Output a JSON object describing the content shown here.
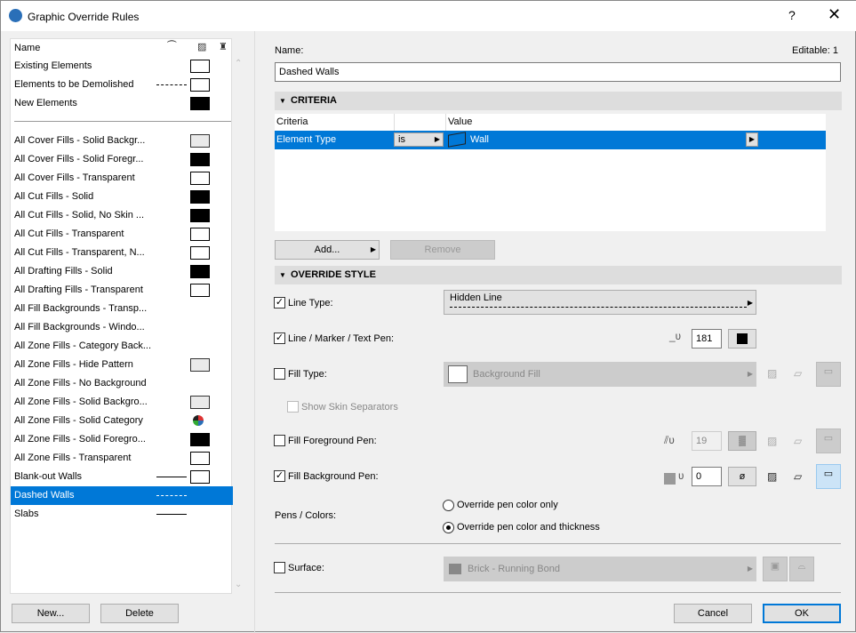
{
  "window": {
    "title": "Graphic Override Rules",
    "help": "?",
    "close": "✕"
  },
  "list": {
    "header": "Name",
    "items": [
      {
        "label": "Existing Elements",
        "swatch": "white",
        "line": ""
      },
      {
        "label": "Elements to be Demolished",
        "swatch": "white",
        "line": "dash"
      },
      {
        "label": "New Elements",
        "swatch": "black",
        "line": ""
      },
      {
        "label": "All Cover Fills - Solid Backgr...",
        "swatch": "gray",
        "line": ""
      },
      {
        "label": "All Cover Fills - Solid Foregr...",
        "swatch": "black",
        "line": ""
      },
      {
        "label": "All Cover Fills - Transparent",
        "swatch": "white",
        "line": ""
      },
      {
        "label": "All Cut Fills - Solid",
        "swatch": "black",
        "line": ""
      },
      {
        "label": "All Cut Fills - Solid, No Skin ...",
        "swatch": "black",
        "line": ""
      },
      {
        "label": "All Cut Fills - Transparent",
        "swatch": "white",
        "line": ""
      },
      {
        "label": "All Cut Fills - Transparent, N...",
        "swatch": "white",
        "line": ""
      },
      {
        "label": "All Drafting Fills - Solid",
        "swatch": "black",
        "line": ""
      },
      {
        "label": "All Drafting Fills - Transparent",
        "swatch": "white",
        "line": ""
      },
      {
        "label": "All Fill Backgrounds - Transp...",
        "swatch": "",
        "line": ""
      },
      {
        "label": "All Fill Backgrounds - Windo...",
        "swatch": "",
        "line": ""
      },
      {
        "label": "All Zone Fills - Category Back...",
        "swatch": "",
        "line": ""
      },
      {
        "label": "All Zone Fills - Hide Pattern",
        "swatch": "gray",
        "line": ""
      },
      {
        "label": "All Zone Fills - No Background",
        "swatch": "",
        "line": ""
      },
      {
        "label": "All Zone Fills - Solid Backgro...",
        "swatch": "gray",
        "line": ""
      },
      {
        "label": "All Zone Fills - Solid Category",
        "swatch": "category",
        "line": ""
      },
      {
        "label": "All Zone Fills - Solid Foregro...",
        "swatch": "black",
        "line": ""
      },
      {
        "label": "All Zone Fills - Transparent",
        "swatch": "white",
        "line": ""
      },
      {
        "label": "Blank-out Walls",
        "swatch": "white",
        "line": "solid"
      },
      {
        "label": "Dashed Walls",
        "swatch": "",
        "line": "dash",
        "selected": true
      },
      {
        "label": "Slabs",
        "swatch": "",
        "line": "solid"
      }
    ],
    "new": "New...",
    "delete": "Delete"
  },
  "rule": {
    "name_label": "Name:",
    "editable": "Editable: 1",
    "name": "Dashed Walls"
  },
  "criteria": {
    "title": "CRITERIA",
    "col_criteria": "Criteria",
    "col_value": "Value",
    "row": {
      "criteria": "Element Type",
      "operator": "is",
      "value": "Wall"
    },
    "add": "Add...",
    "remove": "Remove"
  },
  "override": {
    "title": "OVERRIDE STYLE",
    "line_type": {
      "label": "Line Type:",
      "checked": true,
      "value": "Hidden Line"
    },
    "pen": {
      "label": "Line / Marker / Text Pen:",
      "checked": true,
      "value": "181"
    },
    "fill_type": {
      "label": "Fill Type:",
      "checked": false,
      "value": "Background Fill"
    },
    "skin": {
      "label": "Show Skin Separators",
      "checked": false
    },
    "fill_fg": {
      "label": "Fill Foreground Pen:",
      "checked": false,
      "value": "19"
    },
    "fill_bg": {
      "label": "Fill Background Pen:",
      "checked": true,
      "value": "0"
    },
    "pens_colors": {
      "label": "Pens / Colors:",
      "opt1": "Override pen color only",
      "opt2": "Override pen color and thickness",
      "selected": 2
    },
    "surface": {
      "label": "Surface:",
      "checked": false,
      "value": "Brick - Running Bond"
    }
  },
  "footer": {
    "cancel": "Cancel",
    "ok": "OK"
  }
}
